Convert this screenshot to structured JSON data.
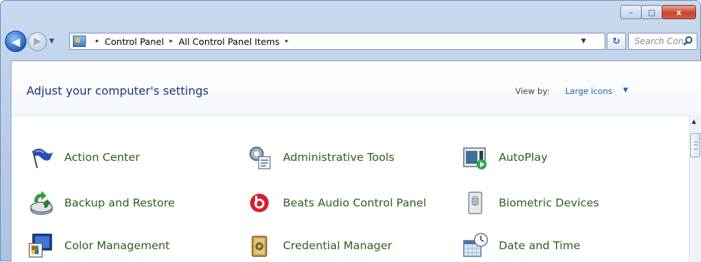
{
  "window": {
    "caption_buttons": {
      "minimize": "–",
      "maximize": "▢",
      "close": "x"
    }
  },
  "nav": {
    "back_glyph": "◀",
    "forward_glyph": "▶",
    "recent_glyph": "▼"
  },
  "address_bar": {
    "separator": "▸",
    "crumbs": [
      "Control Panel",
      "All Control Panel Items"
    ],
    "dropdown_glyph": "▼"
  },
  "refresh_glyph": "↻",
  "search": {
    "placeholder": "Search Con..."
  },
  "page": {
    "title": "Adjust your computer's settings",
    "view_by_label": "View by:",
    "view_by_value": "Large icons",
    "view_by_glyph": "▼"
  },
  "items": [
    {
      "label": "Action Center",
      "icon": "action-center-flag-icon"
    },
    {
      "label": "Administrative Tools",
      "icon": "administrative-tools-icon"
    },
    {
      "label": "AutoPlay",
      "icon": "autoplay-icon"
    },
    {
      "label": "Backup and Restore",
      "icon": "backup-restore-icon"
    },
    {
      "label": "Beats Audio Control Panel",
      "icon": "beats-audio-icon"
    },
    {
      "label": "Biometric Devices",
      "icon": "biometric-devices-icon"
    },
    {
      "label": "Color Management",
      "icon": "color-management-icon"
    },
    {
      "label": "Credential Manager",
      "icon": "credential-manager-icon"
    },
    {
      "label": "Date and Time",
      "icon": "date-time-icon"
    }
  ],
  "colors": {
    "link_green": "#2b5e1c",
    "title_blue": "#1e3287",
    "close_red": "#c9452e"
  }
}
